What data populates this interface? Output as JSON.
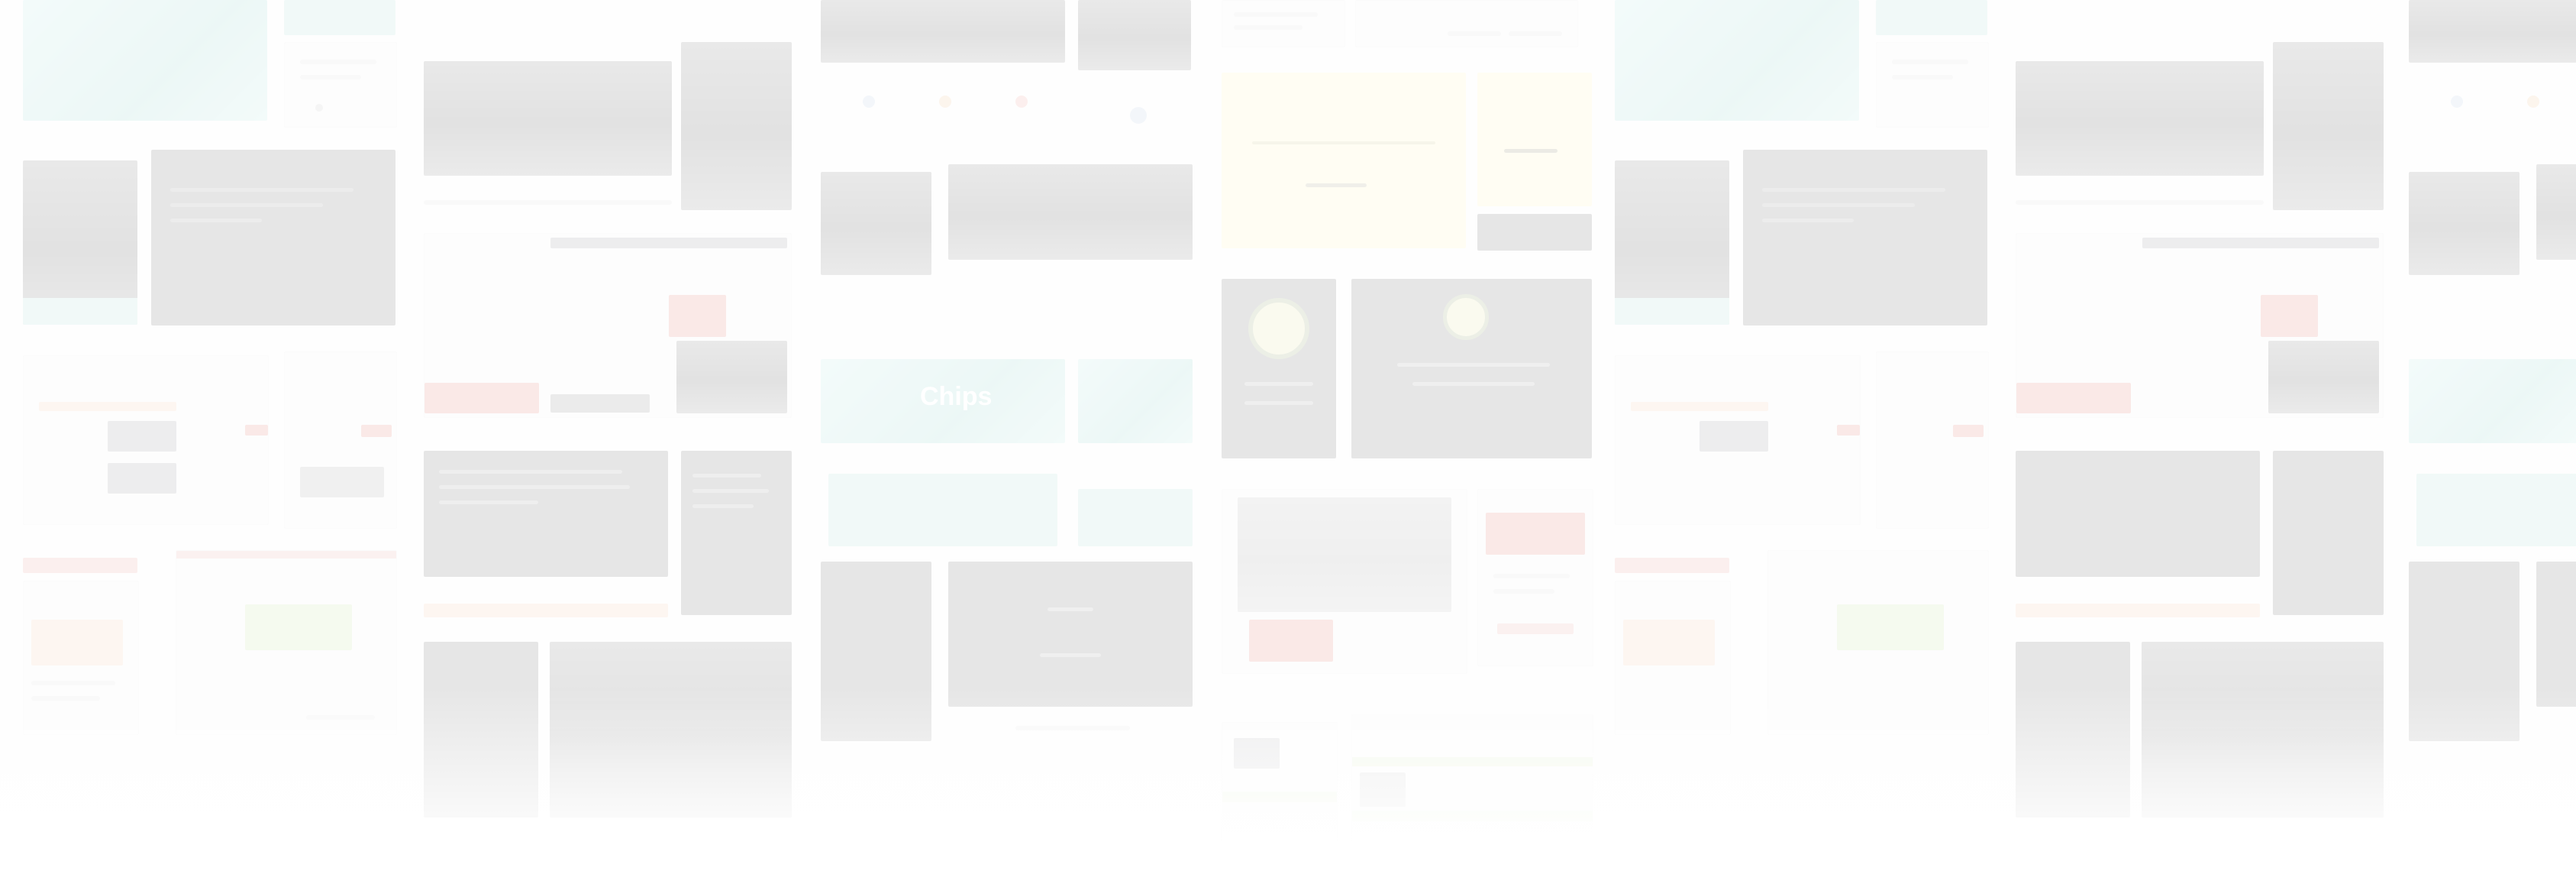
{
  "scene": {
    "kind": "faded collage of website template thumbnails",
    "background_color": "#fbfbfb",
    "palette": {
      "teal": "#bfe3df",
      "cream": "#fdf7c9",
      "dark": "#8f8f8f",
      "accent_red": "#e89a92",
      "accent_orange": "#f7d7bd",
      "accent_green": "#cfe6b8"
    }
  },
  "labels": {
    "yellow_banner": "",
    "teal_banner": "Chips"
  }
}
